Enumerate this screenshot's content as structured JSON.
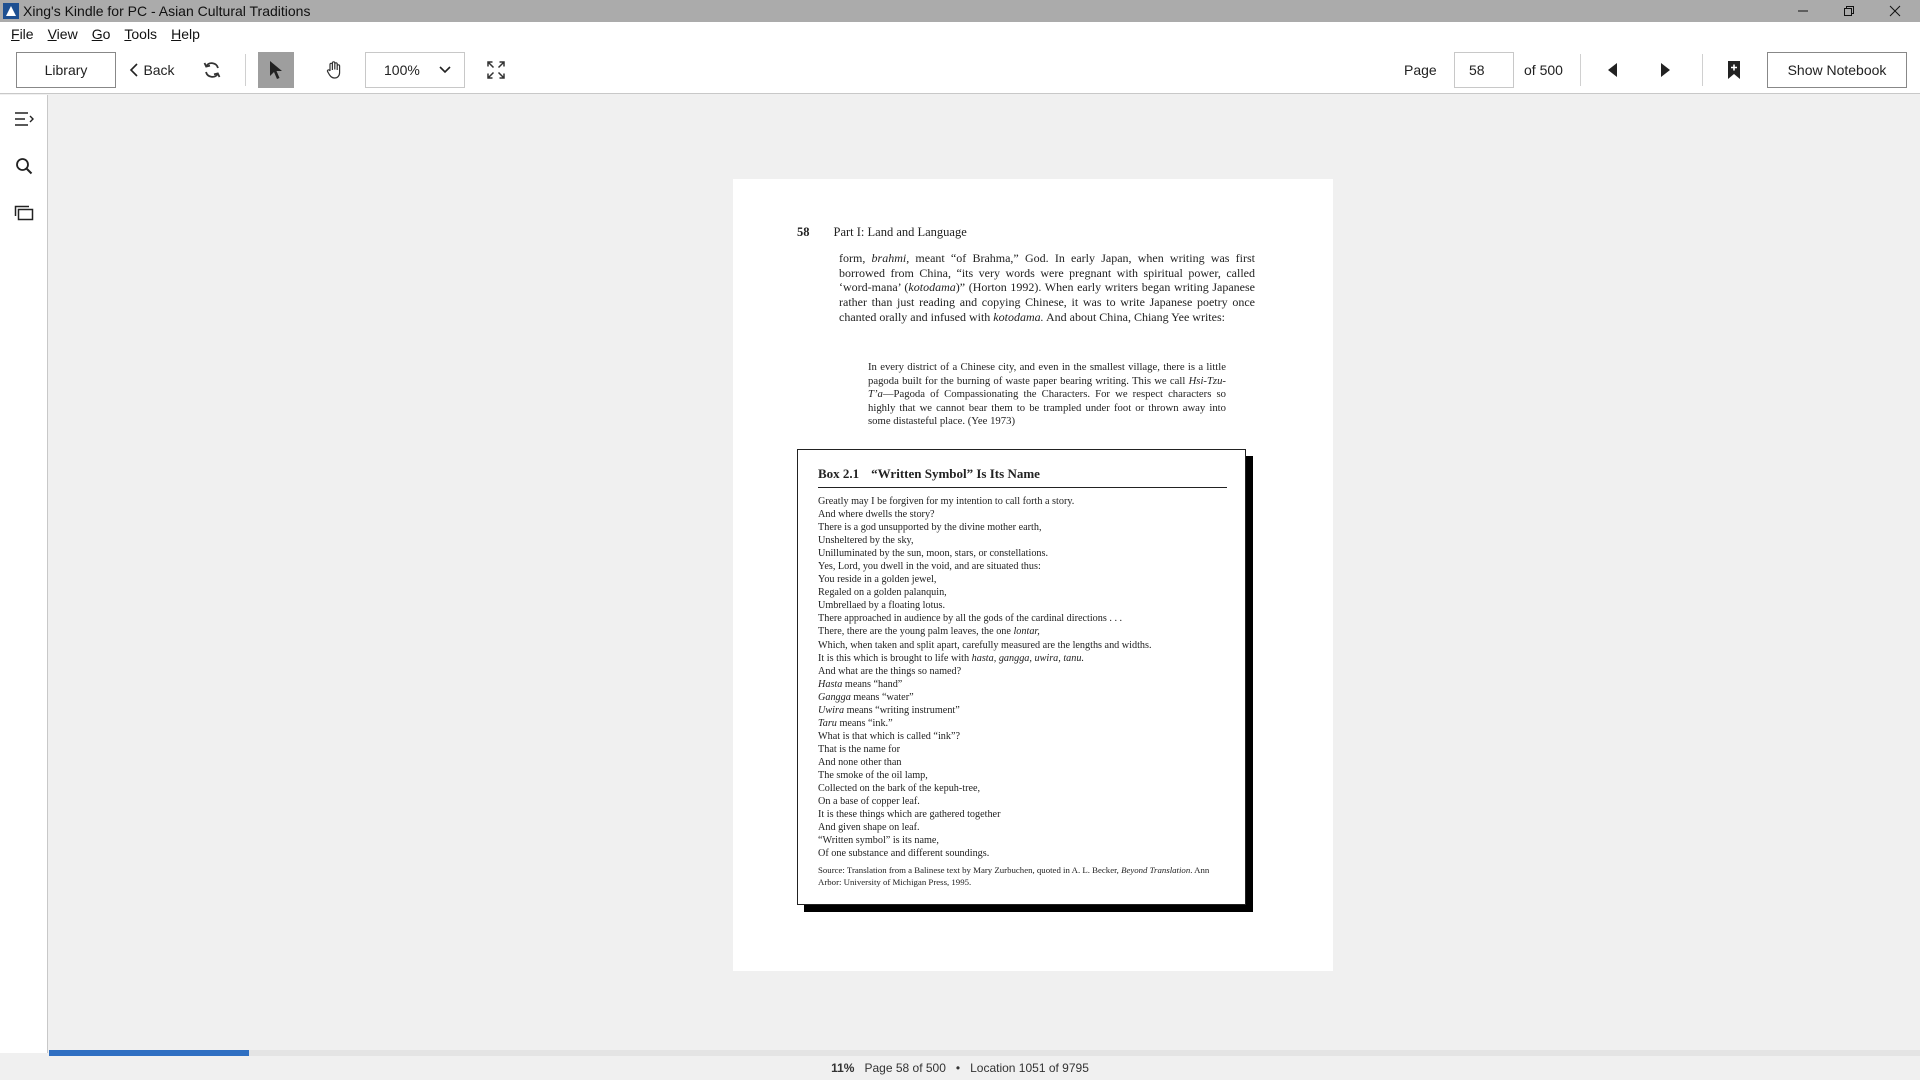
{
  "window": {
    "title": "Xing's Kindle for PC - Asian Cultural Traditions"
  },
  "menu": [
    {
      "key": "F",
      "rest": "ile"
    },
    {
      "key": "V",
      "rest": "iew"
    },
    {
      "key": "G",
      "rest": "o"
    },
    {
      "key": "T",
      "rest": "ools"
    },
    {
      "key": "H",
      "rest": "elp"
    }
  ],
  "toolbar": {
    "library_label": "Library",
    "back_label": "Back",
    "zoom_value": "100%",
    "page_label": "Page",
    "page_value": "58",
    "page_of": "of 500",
    "notebook_label": "Show Notebook"
  },
  "icons": {
    "sync": "sync-icon",
    "select": "cursor-arrow-icon",
    "hand": "hand-pan-icon",
    "fullscreen": "fullscreen-icon",
    "prev": "triangle-left-icon",
    "next": "triangle-right-icon",
    "bookmark": "bookmark-plus-icon",
    "toc": "table-of-contents-icon",
    "search": "search-icon",
    "flashcards": "flashcards-icon"
  },
  "book_page": {
    "page_number": "58",
    "running_head": "Part I: Land and Language",
    "body_paragraph": [
      "form, ",
      {
        "i": "brahmi"
      },
      ", meant “of Brahma,” God. In early Japan, when writing was first borrowed from China, “its very words were pregnant with spiritual power, called ‘word-mana’ (",
      {
        "i": "kotodama"
      },
      ")” (Horton 1992). When early writers began writing Japanese rather than just reading and copying Chinese, it was to write Japanese poetry once chanted orally and infused with ",
      {
        "i": "kotodama."
      },
      " And about China, Chiang Yee writes:"
    ],
    "quote": [
      "In every district of a Chinese city, and even in the smallest village, there is a little pagoda built for the burning of waste paper bearing writing. This we call ",
      {
        "i": "Hsi-Tzu-T’a"
      },
      "—Pagoda of Compassionating the Characters. For we respect characters so highly that we cannot bear them to be trampled under foot or thrown away into some distasteful place. (Yee 1973)"
    ],
    "box": {
      "number": "Box 2.1",
      "title": "“Written Symbol” Is Its Name",
      "lines": [
        [
          "Greatly may I be forgiven for my intention to call forth a story."
        ],
        [
          "And where dwells the story?"
        ],
        [
          "There is a god unsupported by the divine mother earth,"
        ],
        [
          "Unsheltered by the sky,"
        ],
        [
          "Unilluminated by the sun, moon, stars, or constellations."
        ],
        [
          "Yes, Lord, you dwell in the void, and are situated thus:"
        ],
        [
          "You reside in a golden jewel,"
        ],
        [
          "Regaled on a golden palanquin,"
        ],
        [
          "Umbrellaed by a floating lotus."
        ],
        [
          "There approached in audience by all the gods of the cardinal directions  .  .  ."
        ],
        [
          "There, there are the young palm leaves, the one ",
          {
            "i": "lontar,"
          }
        ],
        [
          "Which, when taken and split apart, carefully measured are the lengths and widths."
        ],
        [
          "It is this which is brought to life with ",
          {
            "i": "hasta, gangga, uwira, tanu."
          }
        ],
        [
          "And what are the things so named?"
        ],
        [
          {
            "i": "Hasta"
          },
          " means “hand”"
        ],
        [
          {
            "i": "Gangga"
          },
          " means “water”"
        ],
        [
          {
            "i": "Uwira"
          },
          " means “writing instrument”"
        ],
        [
          {
            "i": "Taru"
          },
          " means “ink.”"
        ],
        [
          "What is that which is called “ink”?"
        ],
        [
          "That is the name for"
        ],
        [
          "And none other than"
        ],
        [
          "The smoke of the oil lamp,"
        ],
        [
          "Collected on the bark of the kepuh-tree,"
        ],
        [
          "On a base of copper leaf."
        ],
        [
          "It is these things which are gathered together"
        ],
        [
          "And given shape on leaf."
        ],
        [
          "“Written symbol” is its name,"
        ],
        [
          "Of one substance and different soundings."
        ]
      ],
      "source": [
        "Source: Translation from a Balinese text by Mary Zurbuchen, quoted in A. L. Becker, ",
        {
          "i": "Beyond Translation"
        },
        ". Ann Arbor: University of Michigan Press, 1995."
      ]
    }
  },
  "status": {
    "percent": "11%",
    "page_info": "Page 58 of 500",
    "separator": "•",
    "location": "Location 1051 of 9795"
  },
  "reading_progress": 0.11,
  "colors": {
    "titlebar": "#ababab",
    "progress": "#2f6fc2",
    "select_active": "#9e9e9e"
  }
}
